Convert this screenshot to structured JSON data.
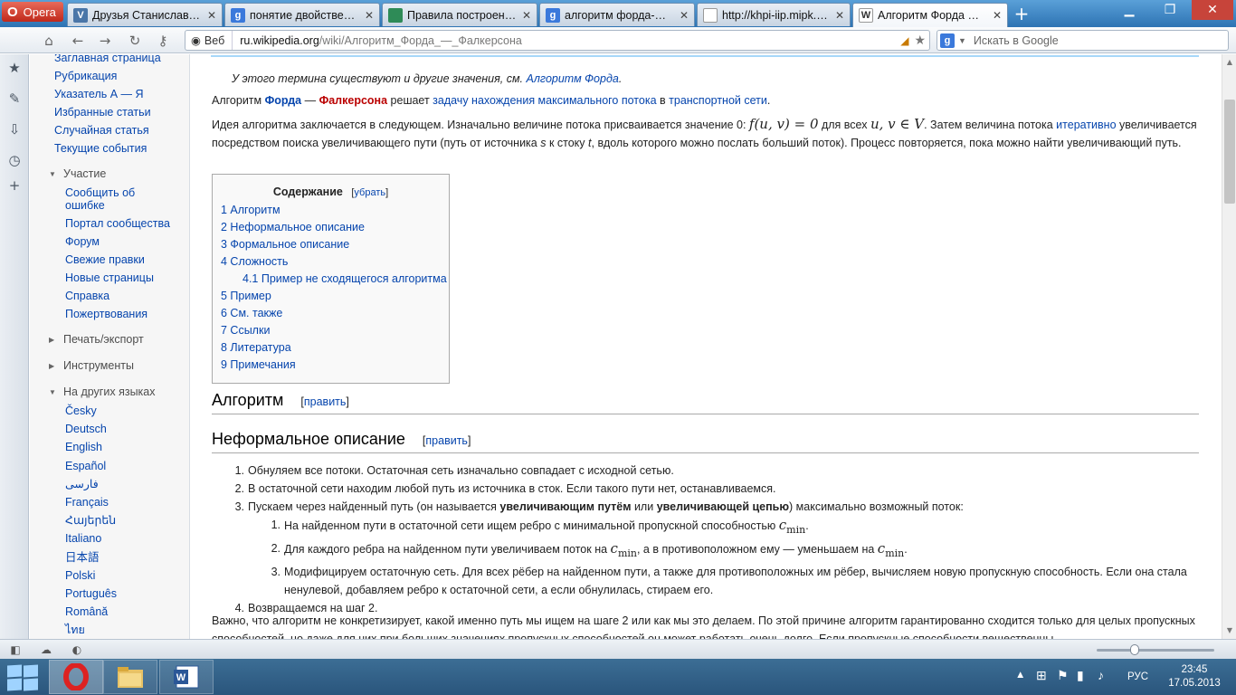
{
  "browser": {
    "menu_label": "Opera",
    "tabs": [
      {
        "label": "Друзья Станислава Ду...",
        "fav": "V",
        "favcolor": "#4a76a8"
      },
      {
        "label": "понятие двойственно...",
        "fav": "g",
        "favcolor": "#3b79db"
      },
      {
        "label": "Правила построения ...",
        "fav": "",
        "favcolor": "#2e8b57"
      },
      {
        "label": "алгоритм форда-фал...",
        "fav": "g",
        "favcolor": "#3b79db"
      },
      {
        "label": "http://khpi-iip.mipk.kh...",
        "fav": "",
        "favcolor": "#ffffff"
      },
      {
        "label": "Алгоритм Форда — Ф...",
        "fav": "W",
        "favcolor": "#ffffff"
      }
    ],
    "address": {
      "web_label": "Веб",
      "url_domain": "ru.wikipedia.org",
      "url_path": "/wiki/Алгоритм_Форда_—_Фалкерсона"
    },
    "search_placeholder": "Искать в Google"
  },
  "sidebar": {
    "top_links": [
      "Заглавная страница",
      "Рубрикация",
      "Указатель А — Я",
      "Избранные статьи",
      "Случайная статья",
      "Текущие события"
    ],
    "participation": {
      "heading": "Участие",
      "links": [
        "Сообщить об ошибке",
        "Портал сообщества",
        "Форум",
        "Свежие правки",
        "Новые страницы",
        "Справка",
        "Пожертвования"
      ]
    },
    "print_heading": "Печать/экспорт",
    "tools_heading": "Инструменты",
    "languages": {
      "heading": "На других языках",
      "links": [
        "Česky",
        "Deutsch",
        "English",
        "Español",
        "فارسی",
        "Français",
        "Հայերեն",
        "Italiano",
        "日本語",
        "Polski",
        "Português",
        "Română",
        "ไทย"
      ]
    }
  },
  "article": {
    "hatnote_prefix": "У этого термина существуют и другие значения, см.",
    "hatnote_link": "Алгоритм Форда",
    "intro": {
      "t1": "Алгоритм ",
      "ford": "Форда",
      "dash": " — ",
      "fulk": "Фалкерсона",
      "t2": " решает ",
      "link1": "задачу нахождения максимального потока",
      "t3": " в ",
      "link2": "транспортной сети",
      "t4": "."
    },
    "idea": {
      "t1": "Идея алгоритма заключается в следующем. Изначально величине потока присваивается значение 0: ",
      "m1": "f(u, v) = 0",
      "t2": " для всех ",
      "m2": "u, v ∈ V",
      "t3": ". Затем величина потока ",
      "link": "итеративно",
      "t4": " увеличивается посредством поиска увеличивающего пути (путь от источника ",
      "s": "s",
      "t5": " к стоку ",
      "t": "t",
      "t6": ", вдоль которого можно послать больший поток). Процесс повторяется, пока можно найти увеличивающий путь."
    },
    "toc": {
      "title": "Содержание",
      "toggle": "убрать",
      "items": [
        "1 Алгоритм",
        "2 Неформальное описание",
        "3 Формальное описание",
        "4 Сложность",
        "4.1 Пример не сходящегося алгоритма",
        "5 Пример",
        "6 См. также",
        "7 Ссылки",
        "8 Литература",
        "9 Примечания"
      ]
    },
    "edit_label": "править",
    "h_algorithm": "Алгоритм",
    "h_informal": "Неформальное описание",
    "steps": {
      "s1": "Обнуляем все потоки. Остаточная сеть изначально совпадает с исходной сетью.",
      "s2": "В остаточной сети находим любой путь из источника в сток. Если такого пути нет, останавливаемся.",
      "s3a": "Пускаем через найденный путь (он называется ",
      "s3b": "увеличивающим путём",
      "s3c": " или ",
      "s3d": "увеличивающей цепью",
      "s3e": ") максимально возможный поток:",
      "sub1": "На найденном пути в остаточной сети ищем ребро с минимальной пропускной способностью ",
      "sub2a": "Для каждого ребра на найденном пути увеличиваем поток на ",
      "sub2b": ", а в противоположном ему — уменьшаем на ",
      "sub3": "Модифицируем остаточную сеть. Для всех рёбер на найденном пути, а также для противоположных им рёбер, вычисляем новую пропускную способность. Если она стала ненулевой, добавляем ребро к остаточной сети, а если обнулилась, стираем его.",
      "s4": "Возвращаемся на шаг 2.",
      "cmin": "c",
      "cmin_sub": "min"
    },
    "bottom": "Важно, что алгоритм не конкретизирует, какой именно путь мы ищем на шаге 2 или как мы это делаем. По этой причине алгоритм гарантированно сходится только для целых пропускных способностей, но даже для них при больших значениях пропускных способностей он может работать очень долго. Если пропускные способности вещественны,"
  },
  "taskbar": {
    "lang": "РУС",
    "time": "23:45",
    "date": "17.05.2013"
  }
}
